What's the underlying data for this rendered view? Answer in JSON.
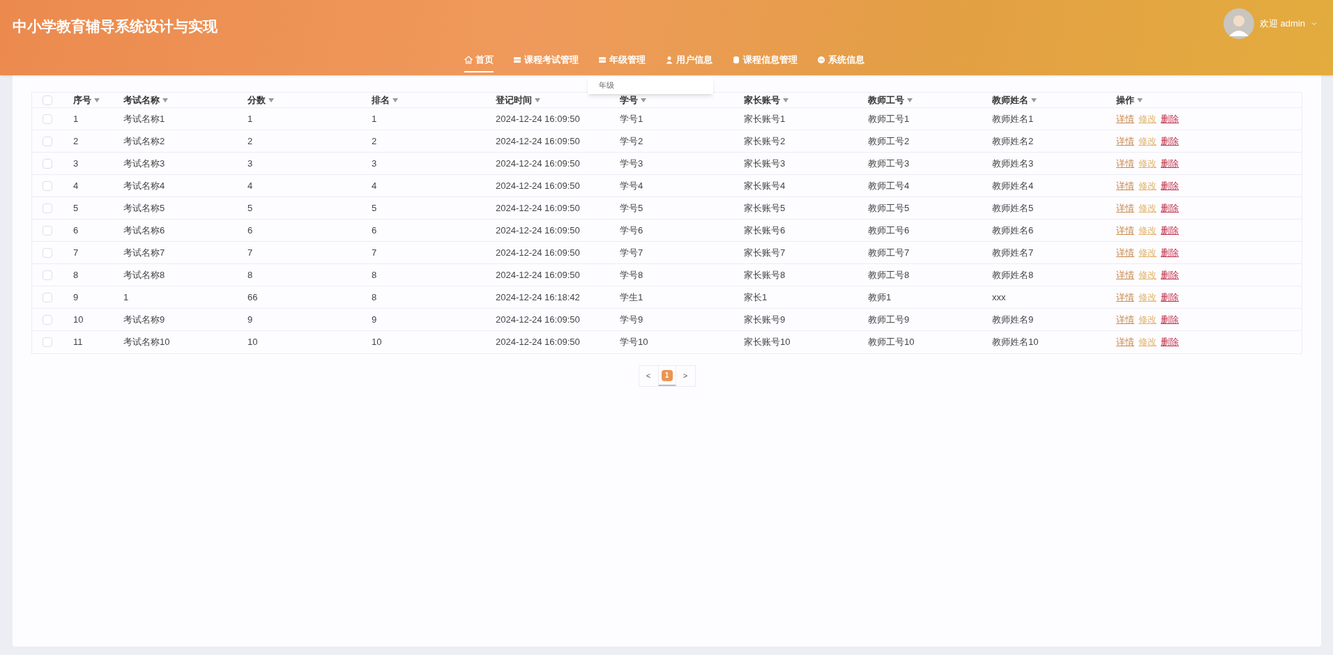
{
  "header": {
    "title": "中小学教育辅导系统设计与实现",
    "user": "欢迎 admin"
  },
  "nav": [
    {
      "label": "首页",
      "kind": "home",
      "selected": true
    },
    {
      "label": "课程考试管理",
      "kind": "table",
      "selected": false
    },
    {
      "label": "年级管理",
      "kind": "table",
      "selected": false
    },
    {
      "label": "用户信息",
      "kind": "user",
      "selected": false
    },
    {
      "label": "课程信息管理",
      "kind": "database",
      "selected": false
    },
    {
      "label": "系统信息",
      "kind": "more",
      "selected": false
    }
  ],
  "dropdown": {
    "items": [
      "年级"
    ]
  },
  "table": {
    "select_all": {
      "checked": false
    },
    "columns": [
      "序号",
      "考试名称",
      "分数",
      "排名",
      "登记时间",
      "学号",
      "家长账号",
      "教师工号",
      "教师姓名",
      "操作"
    ],
    "rows": [
      {
        "checked": false,
        "cells": [
          "1",
          "考试名称1",
          "1",
          "1",
          "2024-12-24 16:09:50",
          "学号1",
          "家长账号1",
          "教师工号1",
          "教师姓名1"
        ],
        "actions": [
          {
            "label": "详情",
            "kind": "detail"
          },
          {
            "label": "修改",
            "kind": "edit"
          },
          {
            "label": "删除",
            "kind": "delete"
          }
        ]
      },
      {
        "checked": false,
        "cells": [
          "2",
          "考试名称2",
          "2",
          "2",
          "2024-12-24 16:09:50",
          "学号2",
          "家长账号2",
          "教师工号2",
          "教师姓名2"
        ],
        "actions": [
          {
            "label": "详情",
            "kind": "detail"
          },
          {
            "label": "修改",
            "kind": "edit"
          },
          {
            "label": "删除",
            "kind": "delete"
          }
        ]
      },
      {
        "checked": false,
        "cells": [
          "3",
          "考试名称3",
          "3",
          "3",
          "2024-12-24 16:09:50",
          "学号3",
          "家长账号3",
          "教师工号3",
          "教师姓名3"
        ],
        "actions": [
          {
            "label": "详情",
            "kind": "detail"
          },
          {
            "label": "修改",
            "kind": "edit"
          },
          {
            "label": "删除",
            "kind": "delete"
          }
        ]
      },
      {
        "checked": false,
        "cells": [
          "4",
          "考试名称4",
          "4",
          "4",
          "2024-12-24 16:09:50",
          "学号4",
          "家长账号4",
          "教师工号4",
          "教师姓名4"
        ],
        "actions": [
          {
            "label": "详情",
            "kind": "detail"
          },
          {
            "label": "修改",
            "kind": "edit"
          },
          {
            "label": "删除",
            "kind": "delete"
          }
        ]
      },
      {
        "checked": false,
        "cells": [
          "5",
          "考试名称5",
          "5",
          "5",
          "2024-12-24 16:09:50",
          "学号5",
          "家长账号5",
          "教师工号5",
          "教师姓名5"
        ],
        "actions": [
          {
            "label": "详情",
            "kind": "detail"
          },
          {
            "label": "修改",
            "kind": "edit"
          },
          {
            "label": "删除",
            "kind": "delete"
          }
        ]
      },
      {
        "checked": false,
        "cells": [
          "6",
          "考试名称6",
          "6",
          "6",
          "2024-12-24 16:09:50",
          "学号6",
          "家长账号6",
          "教师工号6",
          "教师姓名6"
        ],
        "actions": [
          {
            "label": "详情",
            "kind": "detail"
          },
          {
            "label": "修改",
            "kind": "edit"
          },
          {
            "label": "删除",
            "kind": "delete"
          }
        ]
      },
      {
        "checked": false,
        "cells": [
          "7",
          "考试名称7",
          "7",
          "7",
          "2024-12-24 16:09:50",
          "学号7",
          "家长账号7",
          "教师工号7",
          "教师姓名7"
        ],
        "actions": [
          {
            "label": "详情",
            "kind": "detail"
          },
          {
            "label": "修改",
            "kind": "edit"
          },
          {
            "label": "删除",
            "kind": "delete"
          }
        ]
      },
      {
        "checked": false,
        "cells": [
          "8",
          "考试名称8",
          "8",
          "8",
          "2024-12-24 16:09:50",
          "学号8",
          "家长账号8",
          "教师工号8",
          "教师姓名8"
        ],
        "actions": [
          {
            "label": "详情",
            "kind": "detail"
          },
          {
            "label": "修改",
            "kind": "edit"
          },
          {
            "label": "删除",
            "kind": "delete"
          }
        ]
      },
      {
        "checked": false,
        "cells": [
          "9",
          "1",
          "66",
          "8",
          "2024-12-24 16:18:42",
          "学生1",
          "家长1",
          "教师1",
          "xxx"
        ],
        "actions": [
          {
            "label": "详情",
            "kind": "detail"
          },
          {
            "label": "修改",
            "kind": "edit"
          },
          {
            "label": "删除",
            "kind": "delete"
          }
        ]
      },
      {
        "checked": false,
        "cells": [
          "10",
          "考试名称9",
          "9",
          "9",
          "2024-12-24 16:09:50",
          "学号9",
          "家长账号9",
          "教师工号9",
          "教师姓名9"
        ],
        "actions": [
          {
            "label": "详情",
            "kind": "detail"
          },
          {
            "label": "修改",
            "kind": "edit"
          },
          {
            "label": "删除",
            "kind": "delete"
          }
        ]
      },
      {
        "checked": false,
        "cells": [
          "11",
          "考试名称10",
          "10",
          "10",
          "2024-12-24 16:09:50",
          "学号10",
          "家长账号10",
          "教师工号10",
          "教师姓名10"
        ],
        "actions": [
          {
            "label": "详情",
            "kind": "detail"
          },
          {
            "label": "修改",
            "kind": "edit"
          },
          {
            "label": "删除",
            "kind": "delete"
          }
        ]
      }
    ]
  },
  "pagination": {
    "prev": "<",
    "next": ">",
    "pages": [
      {
        "label": "1",
        "selected": true
      }
    ]
  }
}
